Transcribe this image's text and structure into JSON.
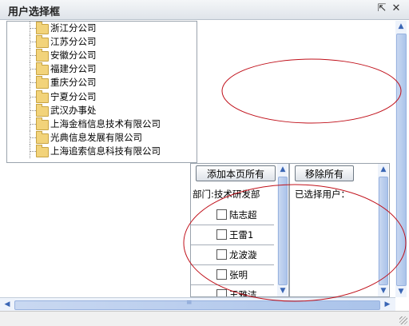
{
  "window": {
    "title": "用户选择框",
    "restore_glyph": "⇱",
    "close_glyph": "✕"
  },
  "tree": {
    "items": [
      {
        "label": "浙江分公司"
      },
      {
        "label": "江苏分公司"
      },
      {
        "label": "安徽分公司"
      },
      {
        "label": "福建分公司"
      },
      {
        "label": "重庆分公司"
      },
      {
        "label": "宁夏分公司"
      },
      {
        "label": "武汉办事处"
      },
      {
        "label": "上海金档信息技术有限公司"
      },
      {
        "label": "光典信息发展有限公司"
      },
      {
        "label": "上海追索信息科技有限公司"
      }
    ]
  },
  "candidates": {
    "add_all_label": "添加本页所有",
    "department_label": "部门:技术研发部",
    "users": [
      {
        "name": "陆志超"
      },
      {
        "name": "王雷1"
      },
      {
        "name": "龙波漩"
      },
      {
        "name": "张明"
      },
      {
        "name": "王雅洁"
      }
    ]
  },
  "selected": {
    "remove_all_label": "移除所有",
    "title_label": "已选择用户："
  },
  "scroll_glyphs": {
    "up": "▲",
    "down": "▼",
    "left": "◀",
    "right": "▶",
    "grip": "≡"
  },
  "colors": {
    "annotation": "#c0101a",
    "scroll_accent": "#3a66b5"
  }
}
